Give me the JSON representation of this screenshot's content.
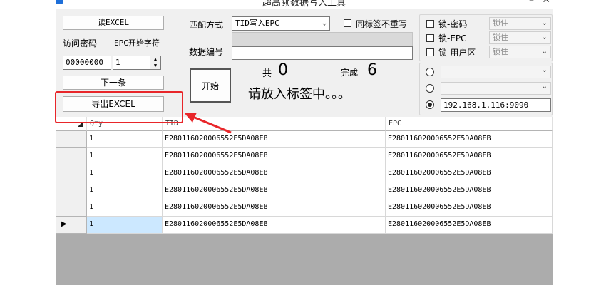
{
  "window": {
    "title": "超高频数据写入工具",
    "logo": "t"
  },
  "left_panel": {
    "read_excel_label": "读EXCEL",
    "access_password_label": "访问密码",
    "epc_start_label": "EPC开始字符",
    "access_password_value": "00000000",
    "epc_start_value": "1",
    "next_label": "下一条",
    "export_label": "导出EXCEL"
  },
  "middle_panel": {
    "match_mode_label": "匹配方式",
    "match_mode_value": "TID写入EPC",
    "same_tag_no_rewrite_label": "同标签不重写",
    "same_tag_no_rewrite_checked": false,
    "data_number_label": "数据编号",
    "start_label": "开始",
    "total_label": "共",
    "total_value": "0",
    "done_label": "完成",
    "done_value": "6",
    "status_text": "请放入标签中。。。"
  },
  "lock_panel": {
    "items": [
      {
        "label": "锁-密码",
        "checked": false,
        "value": "锁住"
      },
      {
        "label": "锁-EPC",
        "checked": false,
        "value": "锁住"
      },
      {
        "label": "锁-用户区",
        "checked": false,
        "value": "锁住"
      }
    ]
  },
  "connection_panel": {
    "ip_value": "192.168.1.116:9090",
    "selected_index": 2
  },
  "grid": {
    "columns": [
      "Qty",
      "TID",
      "EPC"
    ],
    "rows": [
      [
        "1",
        "E280116020006552E5DA08EB",
        "E280116020006552E5DA08EB"
      ],
      [
        "1",
        "E280116020006552E5DA08EB",
        "E280116020006552E5DA08EB"
      ],
      [
        "1",
        "E280116020006552E5DA08EB",
        "E280116020006552E5DA08EB"
      ],
      [
        "1",
        "E280116020006552E5DA08EB",
        "E280116020006552E5DA08EB"
      ],
      [
        "1",
        "E280116020006552E5DA08EB",
        "E280116020006552E5DA08EB"
      ],
      [
        "1",
        "E280116020006552E5DA08EB",
        "E280116020006552E5DA08EB"
      ]
    ],
    "current_row": 5,
    "current_row_marker": "▶"
  },
  "annotation": {
    "color": "#e8262a"
  }
}
